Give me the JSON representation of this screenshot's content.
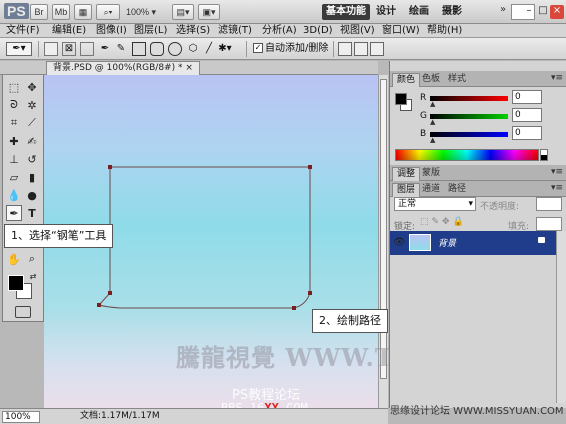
{
  "app": {
    "logo": "PS",
    "buttons": [
      "Br",
      "Mb"
    ],
    "zoom": "100%",
    "workspaces": [
      {
        "label": "基本功能",
        "active": true
      },
      {
        "label": "设计",
        "active": false
      },
      {
        "label": "绘画",
        "active": false
      },
      {
        "label": "摄影",
        "active": false
      }
    ],
    "more": "»"
  },
  "menu": [
    "文件(F)",
    "编辑(E)",
    "图像(I)",
    "图层(L)",
    "选择(S)",
    "滤镜(T)",
    "分析(A)",
    "3D(D)",
    "视图(V)",
    "窗口(W)",
    "帮助(H)"
  ],
  "options": {
    "auto_add_delete": "自动添加/删除",
    "auto_add_checked": true
  },
  "document": {
    "tab_title": "背景.PSD @ 100%(RGB/8#) *",
    "zoom": "100%",
    "doc_info": "文档:1.17M/1.17M"
  },
  "callouts": {
    "step1": "1、选择“钢笔”工具",
    "step2": "2、绘制路径"
  },
  "watermarks": {
    "main": "騰龍視覺 WWW.TLVI.NET",
    "forum": "PS教程论坛",
    "bbs_pre": "BBS.16",
    "bbs_xx": "XX",
    "bbs_post": ".COM",
    "corner": "思缘设计论坛  WWW.MISSYUAN.COM"
  },
  "color_panel": {
    "tabs": [
      {
        "label": "颜色",
        "active": true
      },
      {
        "label": "色板",
        "active": false
      },
      {
        "label": "样式",
        "active": false
      }
    ],
    "channels": [
      {
        "label": "R",
        "value": "0",
        "color": "#e00000"
      },
      {
        "label": "G",
        "value": "0",
        "color": "#00b000"
      },
      {
        "label": "B",
        "value": "0",
        "color": "#0000e0"
      }
    ]
  },
  "adjust_panel": {
    "tabs": [
      {
        "label": "调整",
        "active": true
      },
      {
        "label": "蒙版",
        "active": false
      }
    ]
  },
  "layers_panel": {
    "tabs": [
      {
        "label": "图层",
        "active": true
      },
      {
        "label": "通道",
        "active": false
      },
      {
        "label": "路径",
        "active": false
      }
    ],
    "blend_mode": "正常",
    "opacity_label": "不透明度:",
    "lock_label": "锁定:",
    "fill_label": "填充:",
    "layers": [
      {
        "name": "背景",
        "visible": true,
        "locked": true
      }
    ]
  }
}
